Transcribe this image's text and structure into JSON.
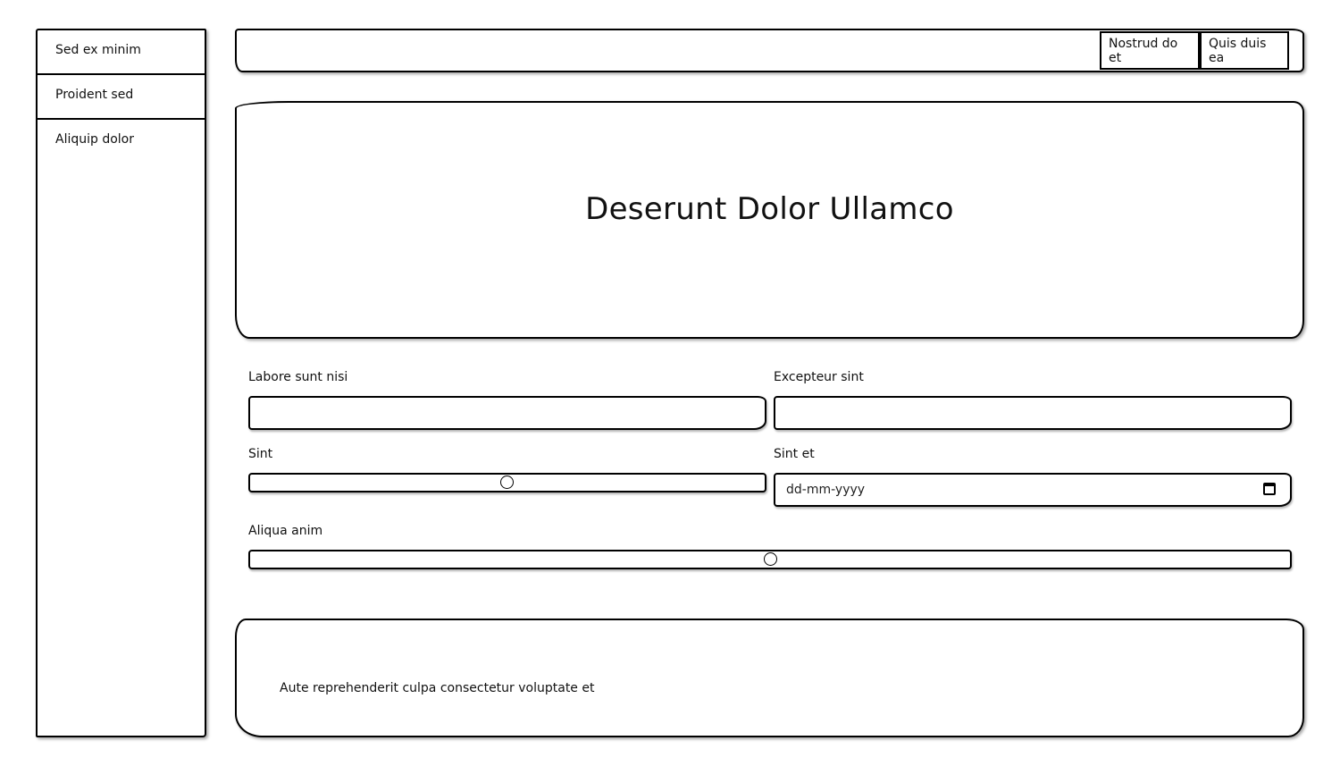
{
  "sidebar": {
    "items": [
      {
        "label": "Sed ex minim"
      },
      {
        "label": "Proident sed"
      },
      {
        "label": "Aliquip dolor"
      }
    ]
  },
  "topbar": {
    "buttons": [
      {
        "label": "Nostrud do et"
      },
      {
        "label": "Quis duis ea"
      }
    ]
  },
  "hero": {
    "title": "Deserunt Dolor Ullamco"
  },
  "form": {
    "field1": {
      "label": "Labore sunt nisi",
      "value": ""
    },
    "field2": {
      "label": "Excepteur sint",
      "value": ""
    },
    "slider1": {
      "label": "Sint",
      "value_fraction": 0.5
    },
    "date": {
      "label": "Sint et",
      "placeholder": "dd-mm-yyyy"
    },
    "slider2": {
      "label": "Aliqua anim",
      "value_fraction": 0.5
    }
  },
  "footer": {
    "text": "Aute reprehenderit culpa consectetur voluptate et"
  }
}
